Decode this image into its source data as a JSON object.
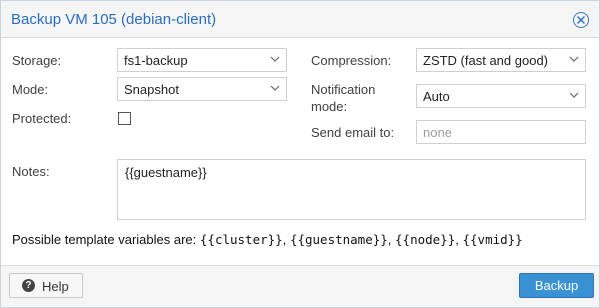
{
  "dialog": {
    "title": "Backup VM 105 (debian-client)",
    "close_icon": "close-circle-icon"
  },
  "form": {
    "storage": {
      "label": "Storage:",
      "value": "fs1-backup"
    },
    "mode": {
      "label": "Mode:",
      "value": "Snapshot"
    },
    "protected": {
      "label": "Protected:",
      "checked": false
    },
    "compression": {
      "label": "Compression:",
      "value": "ZSTD (fast and good)"
    },
    "notification_mode": {
      "label_line1": "Notification",
      "label_line2": "mode:",
      "value": "Auto"
    },
    "send_email": {
      "label": "Send email to:",
      "placeholder": "none"
    },
    "notes": {
      "label": "Notes:",
      "value": "{{guestname}}"
    }
  },
  "hint": {
    "prefix": "Possible template variables are:",
    "vars": [
      "{{cluster}}",
      "{{guestname}}",
      "{{node}}",
      "{{vmid}}"
    ]
  },
  "footer": {
    "help_label": "Help",
    "help_icon": "question-circle-icon",
    "backup_label": "Backup"
  },
  "colors": {
    "title": "#2a6ebb",
    "primary_button": "#3892d4"
  }
}
